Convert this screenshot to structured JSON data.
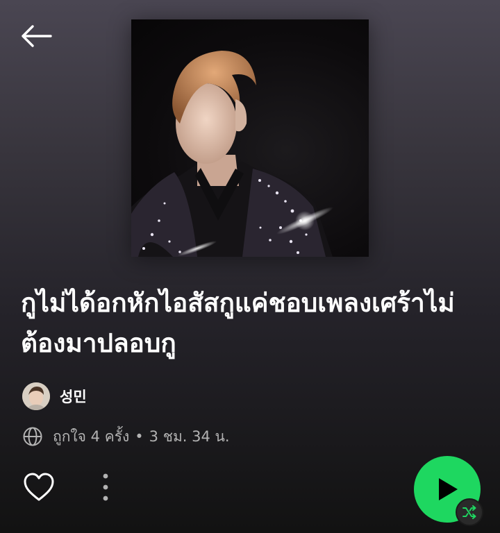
{
  "header": {
    "back_icon": "arrow-left-icon"
  },
  "playlist": {
    "title": "กูไม่ได้อกหักไอสัสกูแค่ชอบเพลงเศร้าไม่ต้องมาปลอบกู",
    "owner_name": "성민",
    "visibility_icon": "globe-icon",
    "likes_text": "ถูกใจ 4 ครั้ง",
    "separator": "•",
    "duration_text": "3 ชม. 34 น."
  },
  "actions": {
    "like_icon": "heart-outline-icon",
    "more_icon": "more-vertical-icon",
    "play_icon": "play-icon",
    "shuffle_icon": "shuffle-icon"
  },
  "colors": {
    "accent": "#1ed760",
    "background_top": "#4a4652",
    "background_bottom": "#121212",
    "meta_text": "#b3b3b3"
  }
}
